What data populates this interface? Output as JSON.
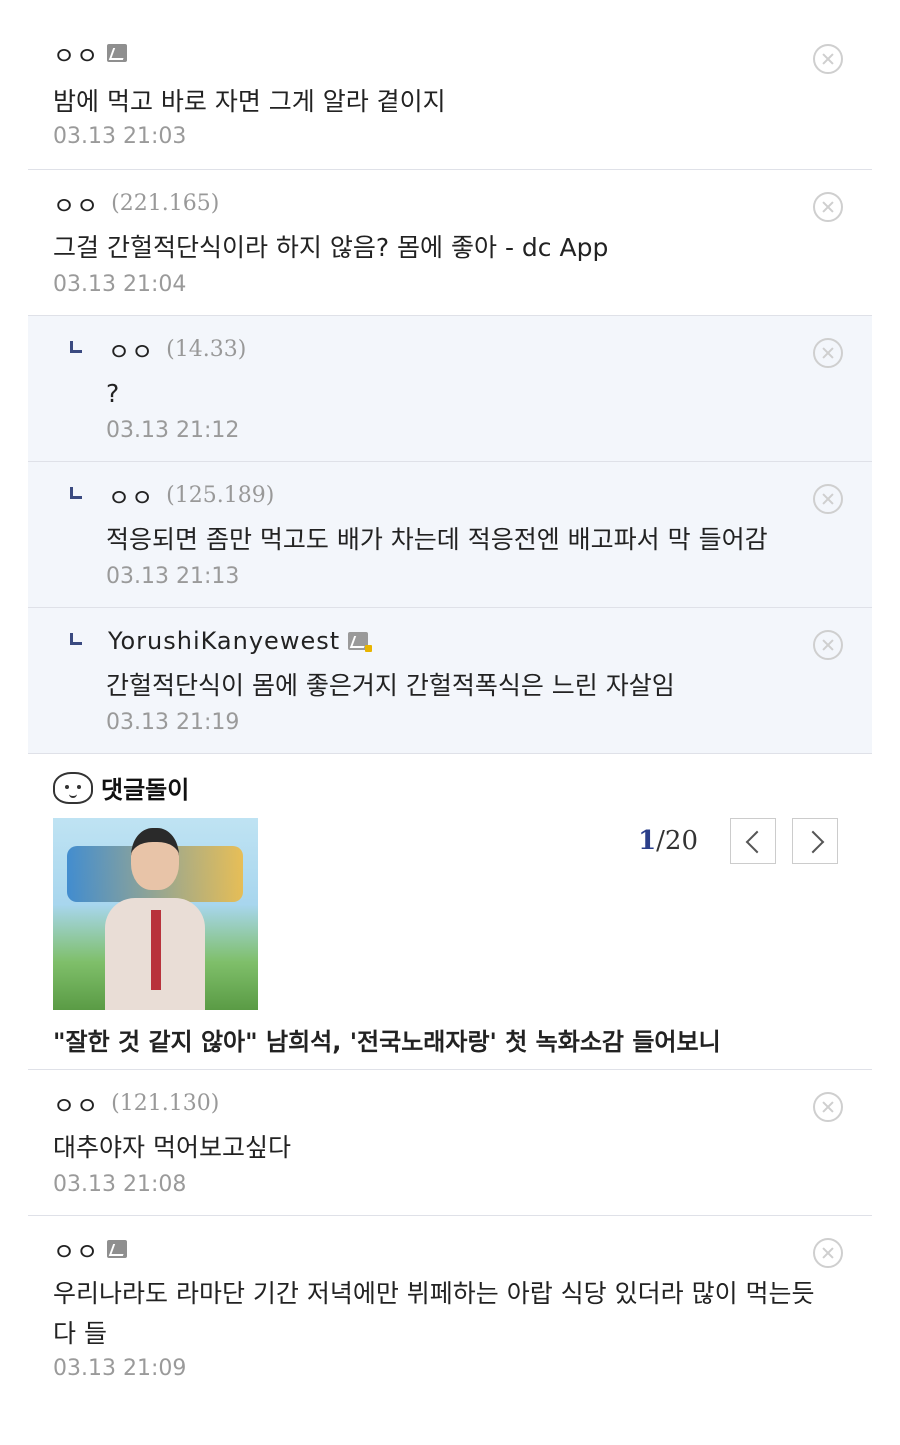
{
  "comments_top": [
    {
      "nick": "ㅇㅇ",
      "ip": "",
      "icon": "fixed-nick-icon",
      "text": "밤에 먹고 바로 자면 그게 알라 곁이지",
      "date": "03.13 21:03"
    },
    {
      "nick": "ㅇㅇ",
      "ip": "(221.165)",
      "icon": "",
      "text": "그걸 간헐적단식이라 하지 않음? 몸에 좋아 - dc App",
      "date": "03.13 21:04"
    }
  ],
  "replies": [
    {
      "nick": "ㅇㅇ",
      "ip": "(14.33)",
      "icon": "",
      "text": "?",
      "date": "03.13 21:12"
    },
    {
      "nick": "ㅇㅇ",
      "ip": "(125.189)",
      "icon": "",
      "text": "적응되면 좀만 먹고도 배가 차는데 적응전엔 배고파서 막 들어감",
      "date": "03.13 21:13"
    },
    {
      "nick": "YorushiKanyewest",
      "ip": "",
      "icon": "fixed-nick-gold-icon",
      "text": "간헐적단식이 몸에 좋은거지 간헐적폭식은 느린 자살임",
      "date": "03.13 21:19"
    }
  ],
  "comment_bot": {
    "label": "댓글돌이",
    "page_current": "1",
    "page_total": "/20",
    "headline": "\"잘한 것 같지 않아\" 남희석, '전국노래자랑' 첫 녹화소감 들어보니"
  },
  "comments_bottom": [
    {
      "nick": "ㅇㅇ",
      "ip": "(121.130)",
      "icon": "",
      "text": "대추야자 먹어보고싶다",
      "date": "03.13 21:08"
    },
    {
      "nick": "ㅇㅇ",
      "ip": "",
      "icon": "fixed-nick-icon",
      "text": "우리나라도 라마단 기간 저녁에만 뷔페하는 아랍 식당 있더라 많이 먹는듯 다 들",
      "date": "03.13 21:09"
    }
  ]
}
